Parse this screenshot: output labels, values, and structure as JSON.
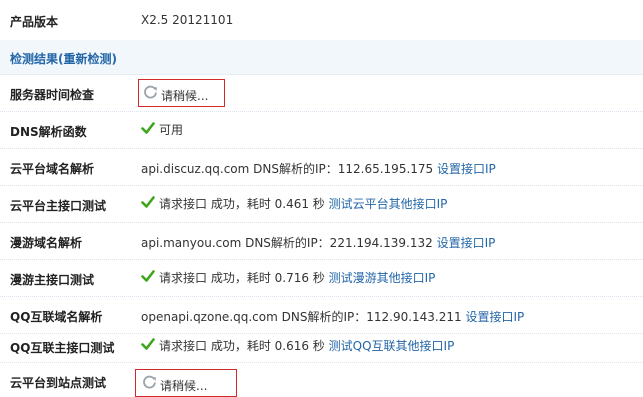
{
  "product_version": {
    "label": "产品版本",
    "value": "X2.5 20121101"
  },
  "section_title": "检测结果(重新检测)",
  "server_time_check": {
    "label": "服务器时间检查",
    "status": "请稍候..."
  },
  "dns_function": {
    "label": "DNS解析函数",
    "status": "可用"
  },
  "cloud_domain": {
    "label": "云平台域名解析",
    "text": "api.discuz.qq.com DNS解析的IP：112.65.195.175",
    "link": "设置接口IP"
  },
  "cloud_main_api": {
    "label": "云平台主接口测试",
    "text": "请求接口 成功，耗时 0.461 秒",
    "link": "测试云平台其他接口IP"
  },
  "manyou_domain": {
    "label": "漫游域名解析",
    "text": "api.manyou.com DNS解析的IP：221.194.139.132",
    "link": "设置接口IP"
  },
  "manyou_main_api": {
    "label": "漫游主接口测试",
    "text": "请求接口 成功，耗时 0.716 秒",
    "link": "测试漫游其他接口IP"
  },
  "qq_domain": {
    "label": "QQ互联域名解析",
    "text": "openapi.qzone.qq.com DNS解析的IP：112.90.143.211",
    "link": "设置接口IP"
  },
  "qq_main_api": {
    "label": "QQ互联主接口测试",
    "text": "请求接口 成功，耗时 0.616 秒",
    "link": "测试QQ互联其他接口IP"
  },
  "cloud_to_site": {
    "label": "云平台到站点测试",
    "status": "请稍候..."
  },
  "colors": {
    "link": "#2366a8",
    "header_bg": "#f2f7fb",
    "highlight_box": "#d22a2a",
    "ok_icon": "#3fa61c"
  },
  "icons": {
    "ok": "check-icon",
    "pending": "refresh-spinner-icon"
  }
}
